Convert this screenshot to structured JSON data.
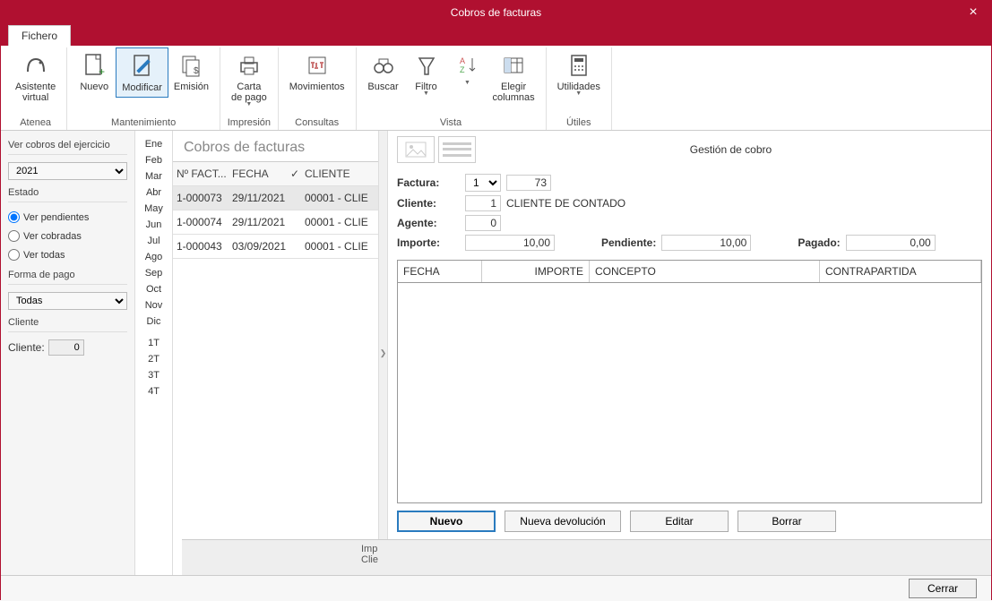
{
  "window": {
    "title": "Cobros de facturas"
  },
  "tabs": {
    "fichero": "Fichero"
  },
  "ribbon": {
    "asistente": {
      "l1": "Asistente",
      "l2": "virtual"
    },
    "nuevo": "Nuevo",
    "modificar": "Modificar",
    "emision": "Emisión",
    "carta": {
      "l1": "Carta",
      "l2": "de pago"
    },
    "movimientos": "Movimientos",
    "buscar": "Buscar",
    "filtro": "Filtro",
    "orden": "",
    "columnas": {
      "l1": "Elegir",
      "l2": "columnas"
    },
    "utilidades": "Utilidades",
    "groups": {
      "atenea": "Atenea",
      "mant": "Mantenimiento",
      "impr": "Impresión",
      "cons": "Consultas",
      "vista": "Vista",
      "utiles": "Útiles"
    }
  },
  "left": {
    "ver_cobros": "Ver cobros del ejercicio",
    "year": "2021",
    "estado": "Estado",
    "pendientes": "Ver pendientes",
    "cobradas": "Ver cobradas",
    "todas": "Ver todas",
    "forma_pago": "Forma de pago",
    "fp_value": "Todas",
    "cliente_section": "Cliente",
    "cliente_label": "Cliente:",
    "cliente_val": "0"
  },
  "months": [
    "Ene",
    "Feb",
    "Mar",
    "Abr",
    "May",
    "Jun",
    "Jul",
    "Ago",
    "Sep",
    "Oct",
    "Nov",
    "Dic",
    "",
    "1T",
    "2T",
    "3T",
    "4T"
  ],
  "list": {
    "title": "Cobros de facturas",
    "headers": {
      "num": "Nº FACT...",
      "fecha": "FECHA",
      "chk": "✓",
      "cliente": "CLIENTE"
    },
    "rows": [
      {
        "num": "1-000073",
        "fecha": "29/11/2021",
        "cliente": "00001 - CLIE"
      },
      {
        "num": "1-000074",
        "fecha": "29/11/2021",
        "cliente": "00001 - CLIE"
      },
      {
        "num": "1-000043",
        "fecha": "03/09/2021",
        "cliente": "00001 - CLIE"
      }
    ]
  },
  "detail": {
    "title": "Gestión de cobro",
    "factura_l": "Factura:",
    "factura_s": "1",
    "factura_n": "73",
    "cliente_l": "Cliente:",
    "cliente_n": "1",
    "cliente_name": "CLIENTE DE CONTADO",
    "agente_l": "Agente:",
    "agente_n": "0",
    "importe_l": "Importe:",
    "importe_v": "10,00",
    "pendiente_l": "Pendiente:",
    "pendiente_v": "10,00",
    "pagado_l": "Pagado:",
    "pagado_v": "0,00",
    "cols": {
      "fecha": "FECHA",
      "importe": "IMPORTE",
      "concepto": "CONCEPTO",
      "contra": "CONTRAPARTIDA"
    },
    "btn": {
      "nuevo": "Nuevo",
      "devolucion": "Nueva devolución",
      "editar": "Editar",
      "borrar": "Borrar"
    }
  },
  "status": {
    "l1": "Imp",
    "l2": "Clie"
  },
  "footer": {
    "cerrar": "Cerrar"
  }
}
